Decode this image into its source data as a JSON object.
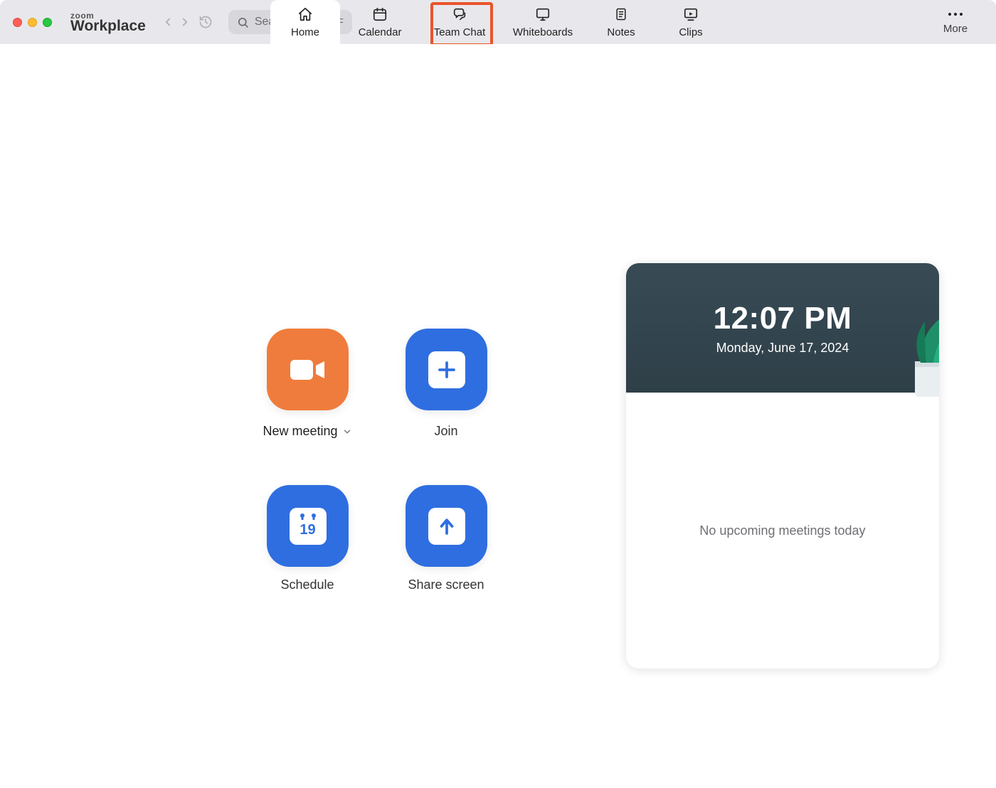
{
  "brand": {
    "logo_top": "zoom",
    "logo_bottom": "Workplace"
  },
  "search": {
    "placeholder": "Search",
    "shortcut": "⌘F"
  },
  "tabs": {
    "home": "Home",
    "calendar": "Calendar",
    "team_chat": "Team Chat",
    "whiteboards": "Whiteboards",
    "notes": "Notes",
    "clips": "Clips",
    "more": "More"
  },
  "actions": {
    "new_meeting": "New meeting",
    "join": "Join",
    "schedule": "Schedule",
    "schedule_day": "19",
    "share_screen": "Share screen"
  },
  "sidebar": {
    "time": "12:07 PM",
    "date": "Monday, June 17, 2024",
    "empty": "No upcoming meetings today"
  }
}
